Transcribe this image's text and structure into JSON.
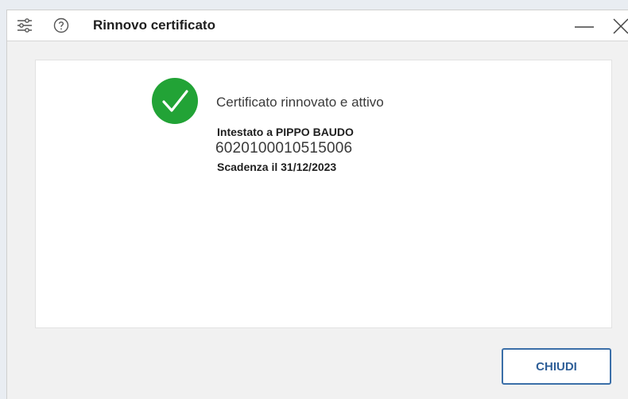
{
  "window": {
    "title": "Rinnovo certificato"
  },
  "dialog": {
    "status": "Certificato rinnovato e attivo",
    "holder": "Intestato a PIPPO BAUDO",
    "certificate_number": "6020100010515006",
    "expiry": "Scadenza il 31/12/2023"
  },
  "actions": {
    "close_label": "CHIUDI"
  },
  "icons": {
    "settings": "sliders-icon",
    "help": "question-circle-icon",
    "minimize": "minus-icon",
    "close": "x-icon",
    "status": "check-circle-icon"
  },
  "colors": {
    "success": "#22a336",
    "accent": "#3b6fa8"
  }
}
